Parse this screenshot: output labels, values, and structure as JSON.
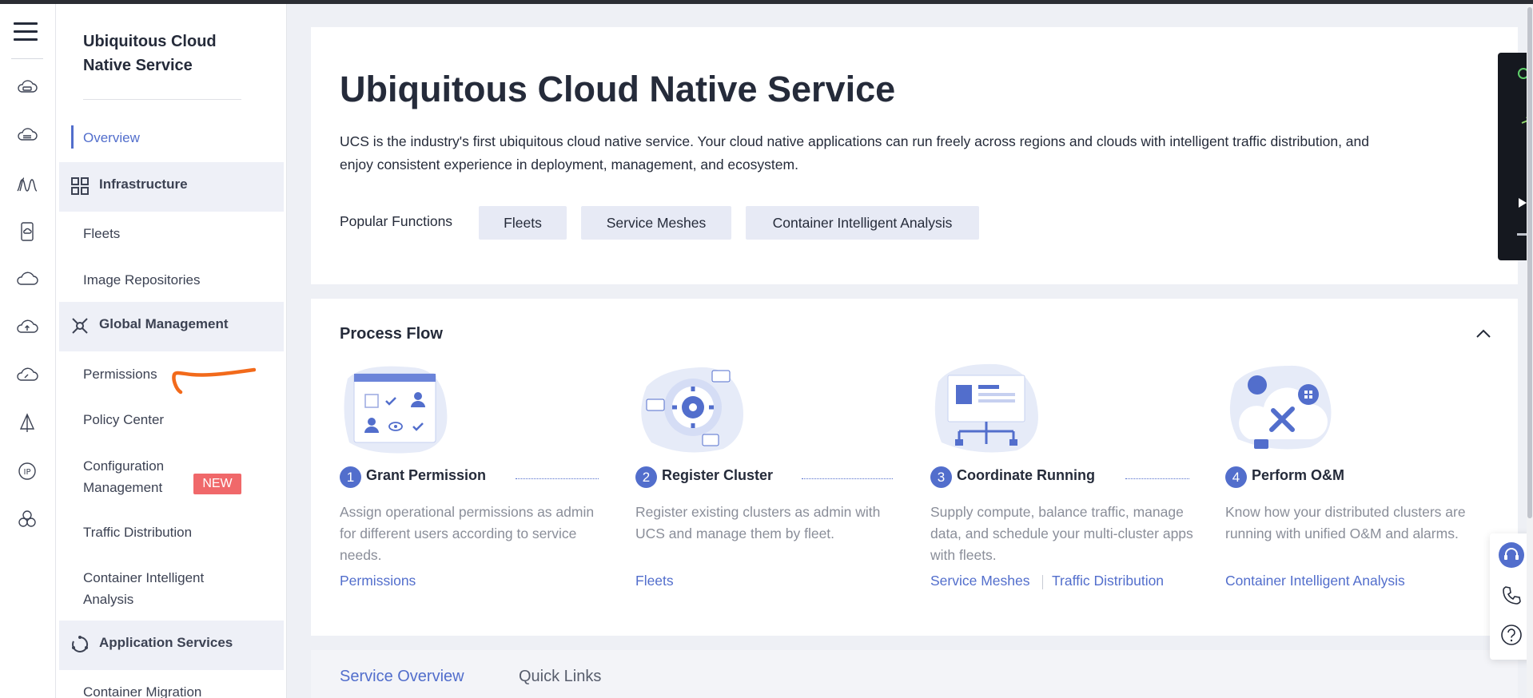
{
  "rail": {
    "icons": [
      "menu-icon",
      "cloud-server-icon",
      "cloud-storage-icon",
      "cluster-wave-icon",
      "mobile-cloud-icon",
      "cloud-icon",
      "cloud-upload-icon",
      "cloud-gauge-icon",
      "sail-icon",
      "ip-icon",
      "nodes-icon"
    ],
    "ip_label": "IP"
  },
  "nav": {
    "title": "Ubiquitous Cloud Native Service",
    "overview": "Overview",
    "groups": {
      "infrastructure": "Infrastructure",
      "global_management": "Global Management",
      "application_services": "Application Services"
    },
    "items": {
      "fleets": "Fleets",
      "image_repositories": "Image Repositories",
      "permissions": "Permissions",
      "policy_center": "Policy Center",
      "configuration_management_line1": "Configuration",
      "configuration_management_line2": "Management",
      "new_badge": "NEW",
      "traffic_distribution": "Traffic Distribution",
      "container_intelligent_analysis_line1": "Container Intelligent",
      "container_intelligent_analysis_line2": "Analysis",
      "container_migration": "Container Migration"
    },
    "annotation_color": "#f26a1b"
  },
  "hero": {
    "title": "Ubiquitous Cloud Native Service",
    "description": "UCS is the industry's first ubiquitous cloud native service. Your cloud native applications can run freely across regions and clouds with intelligent traffic distribution, and enjoy consistent experience in deployment, management, and ecosystem.",
    "popular_label": "Popular Functions",
    "chips": [
      "Fleets",
      "Service Meshes",
      "Container Intelligent Analysis"
    ]
  },
  "process_flow": {
    "title": "Process Flow",
    "steps": [
      {
        "num": "1",
        "title": "Grant Permission",
        "desc": "Assign operational permissions as admin for different users according to service needs.",
        "links": [
          "Permissions"
        ],
        "icon": "permission-illustration-icon"
      },
      {
        "num": "2",
        "title": "Register Cluster",
        "desc": "Register existing clusters as admin with UCS and manage them by fleet.",
        "links": [
          "Fleets"
        ],
        "icon": "register-cluster-illustration-icon"
      },
      {
        "num": "3",
        "title": "Coordinate Running",
        "desc": "Supply compute, balance traffic, manage data, and schedule your multi-cluster apps with fleets.",
        "links": [
          "Service Meshes",
          "Traffic Distribution"
        ],
        "icon": "coordinate-illustration-icon"
      },
      {
        "num": "4",
        "title": "Perform O&M",
        "desc": "Know how your distributed clusters are running with unified O&M and alarms.",
        "links": [
          "Container Intelligent Analysis"
        ],
        "icon": "om-illustration-icon"
      }
    ]
  },
  "bottom_tabs": {
    "service_overview": "Service Overview",
    "quick_links": "Quick Links"
  },
  "colors": {
    "accent": "#526ecc",
    "new_badge": "#f0686a",
    "text": "#252b3a",
    "muted": "#8a8e99"
  }
}
